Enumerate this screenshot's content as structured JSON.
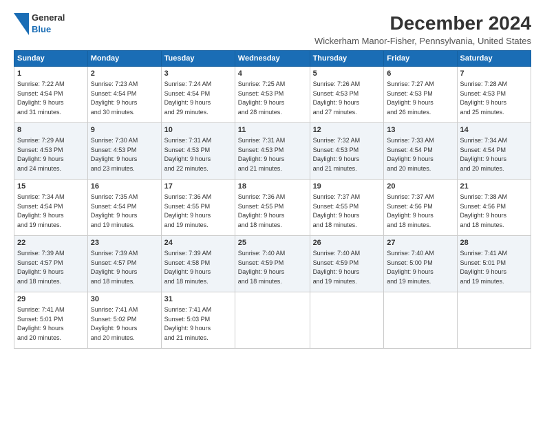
{
  "logo": {
    "line1": "General",
    "line2": "Blue",
    "icon_color": "#1a6db5"
  },
  "title": "December 2024",
  "subtitle": "Wickerham Manor-Fisher, Pennsylvania, United States",
  "days_of_week": [
    "Sunday",
    "Monday",
    "Tuesday",
    "Wednesday",
    "Thursday",
    "Friday",
    "Saturday"
  ],
  "weeks": [
    [
      {
        "day": "1",
        "info": "Sunrise: 7:22 AM\nSunset: 4:54 PM\nDaylight: 9 hours\nand 31 minutes."
      },
      {
        "day": "2",
        "info": "Sunrise: 7:23 AM\nSunset: 4:54 PM\nDaylight: 9 hours\nand 30 minutes."
      },
      {
        "day": "3",
        "info": "Sunrise: 7:24 AM\nSunset: 4:54 PM\nDaylight: 9 hours\nand 29 minutes."
      },
      {
        "day": "4",
        "info": "Sunrise: 7:25 AM\nSunset: 4:53 PM\nDaylight: 9 hours\nand 28 minutes."
      },
      {
        "day": "5",
        "info": "Sunrise: 7:26 AM\nSunset: 4:53 PM\nDaylight: 9 hours\nand 27 minutes."
      },
      {
        "day": "6",
        "info": "Sunrise: 7:27 AM\nSunset: 4:53 PM\nDaylight: 9 hours\nand 26 minutes."
      },
      {
        "day": "7",
        "info": "Sunrise: 7:28 AM\nSunset: 4:53 PM\nDaylight: 9 hours\nand 25 minutes."
      }
    ],
    [
      {
        "day": "8",
        "info": "Sunrise: 7:29 AM\nSunset: 4:53 PM\nDaylight: 9 hours\nand 24 minutes."
      },
      {
        "day": "9",
        "info": "Sunrise: 7:30 AM\nSunset: 4:53 PM\nDaylight: 9 hours\nand 23 minutes."
      },
      {
        "day": "10",
        "info": "Sunrise: 7:31 AM\nSunset: 4:53 PM\nDaylight: 9 hours\nand 22 minutes."
      },
      {
        "day": "11",
        "info": "Sunrise: 7:31 AM\nSunset: 4:53 PM\nDaylight: 9 hours\nand 21 minutes."
      },
      {
        "day": "12",
        "info": "Sunrise: 7:32 AM\nSunset: 4:53 PM\nDaylight: 9 hours\nand 21 minutes."
      },
      {
        "day": "13",
        "info": "Sunrise: 7:33 AM\nSunset: 4:54 PM\nDaylight: 9 hours\nand 20 minutes."
      },
      {
        "day": "14",
        "info": "Sunrise: 7:34 AM\nSunset: 4:54 PM\nDaylight: 9 hours\nand 20 minutes."
      }
    ],
    [
      {
        "day": "15",
        "info": "Sunrise: 7:34 AM\nSunset: 4:54 PM\nDaylight: 9 hours\nand 19 minutes."
      },
      {
        "day": "16",
        "info": "Sunrise: 7:35 AM\nSunset: 4:54 PM\nDaylight: 9 hours\nand 19 minutes."
      },
      {
        "day": "17",
        "info": "Sunrise: 7:36 AM\nSunset: 4:55 PM\nDaylight: 9 hours\nand 19 minutes."
      },
      {
        "day": "18",
        "info": "Sunrise: 7:36 AM\nSunset: 4:55 PM\nDaylight: 9 hours\nand 18 minutes."
      },
      {
        "day": "19",
        "info": "Sunrise: 7:37 AM\nSunset: 4:55 PM\nDaylight: 9 hours\nand 18 minutes."
      },
      {
        "day": "20",
        "info": "Sunrise: 7:37 AM\nSunset: 4:56 PM\nDaylight: 9 hours\nand 18 minutes."
      },
      {
        "day": "21",
        "info": "Sunrise: 7:38 AM\nSunset: 4:56 PM\nDaylight: 9 hours\nand 18 minutes."
      }
    ],
    [
      {
        "day": "22",
        "info": "Sunrise: 7:39 AM\nSunset: 4:57 PM\nDaylight: 9 hours\nand 18 minutes."
      },
      {
        "day": "23",
        "info": "Sunrise: 7:39 AM\nSunset: 4:57 PM\nDaylight: 9 hours\nand 18 minutes."
      },
      {
        "day": "24",
        "info": "Sunrise: 7:39 AM\nSunset: 4:58 PM\nDaylight: 9 hours\nand 18 minutes."
      },
      {
        "day": "25",
        "info": "Sunrise: 7:40 AM\nSunset: 4:59 PM\nDaylight: 9 hours\nand 18 minutes."
      },
      {
        "day": "26",
        "info": "Sunrise: 7:40 AM\nSunset: 4:59 PM\nDaylight: 9 hours\nand 19 minutes."
      },
      {
        "day": "27",
        "info": "Sunrise: 7:40 AM\nSunset: 5:00 PM\nDaylight: 9 hours\nand 19 minutes."
      },
      {
        "day": "28",
        "info": "Sunrise: 7:41 AM\nSunset: 5:01 PM\nDaylight: 9 hours\nand 19 minutes."
      }
    ],
    [
      {
        "day": "29",
        "info": "Sunrise: 7:41 AM\nSunset: 5:01 PM\nDaylight: 9 hours\nand 20 minutes."
      },
      {
        "day": "30",
        "info": "Sunrise: 7:41 AM\nSunset: 5:02 PM\nDaylight: 9 hours\nand 20 minutes."
      },
      {
        "day": "31",
        "info": "Sunrise: 7:41 AM\nSunset: 5:03 PM\nDaylight: 9 hours\nand 21 minutes."
      },
      null,
      null,
      null,
      null
    ]
  ]
}
